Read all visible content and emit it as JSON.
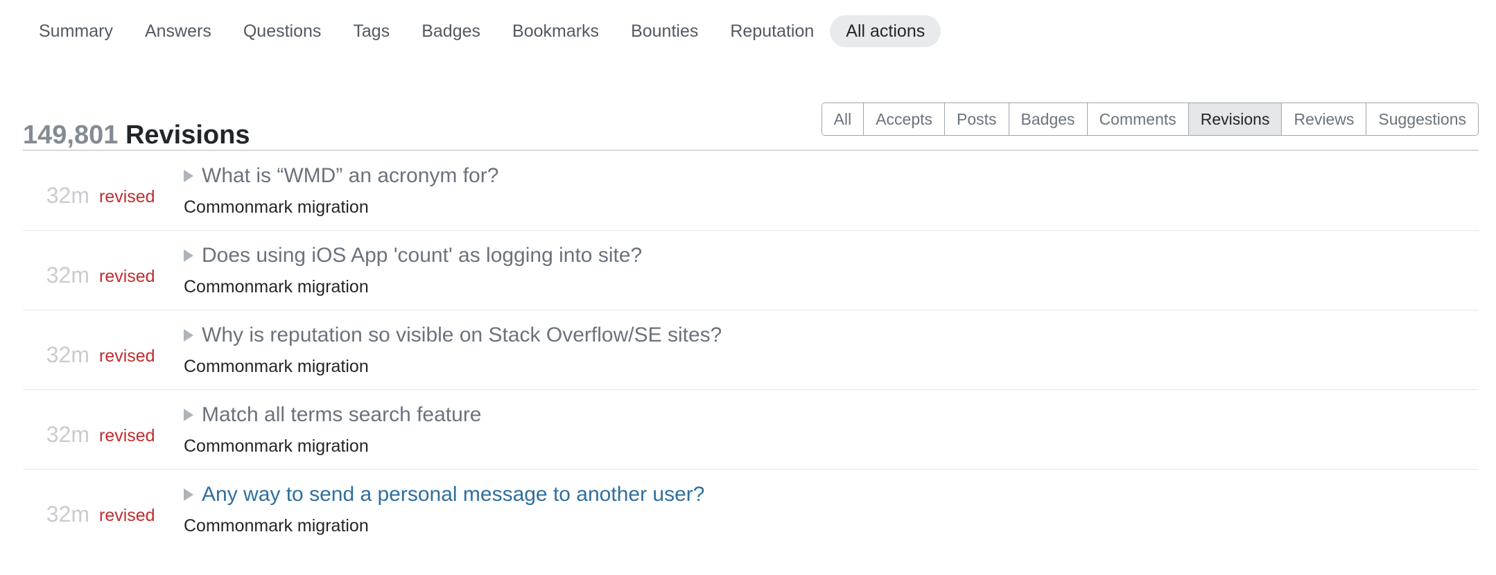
{
  "nav": {
    "items": [
      {
        "label": "Summary",
        "selected": false
      },
      {
        "label": "Answers",
        "selected": false
      },
      {
        "label": "Questions",
        "selected": false
      },
      {
        "label": "Tags",
        "selected": false
      },
      {
        "label": "Badges",
        "selected": false
      },
      {
        "label": "Bookmarks",
        "selected": false
      },
      {
        "label": "Bounties",
        "selected": false
      },
      {
        "label": "Reputation",
        "selected": false
      },
      {
        "label": "All actions",
        "selected": true
      }
    ]
  },
  "header": {
    "count": "149,801",
    "title": "Revisions",
    "filters": [
      {
        "label": "All",
        "selected": false
      },
      {
        "label": "Accepts",
        "selected": false
      },
      {
        "label": "Posts",
        "selected": false
      },
      {
        "label": "Badges",
        "selected": false
      },
      {
        "label": "Comments",
        "selected": false
      },
      {
        "label": "Revisions",
        "selected": true
      },
      {
        "label": "Reviews",
        "selected": false
      },
      {
        "label": "Suggestions",
        "selected": false
      }
    ]
  },
  "activity": {
    "rows": [
      {
        "time": "32m",
        "action": "revised",
        "bullet": "triangle-right-icon",
        "title": "What is “WMD” an acronym for?",
        "title_is_link": false,
        "subtitle": "Commonmark migration"
      },
      {
        "time": "32m",
        "action": "revised",
        "bullet": "triangle-right-icon",
        "title": "Does using iOS App 'count' as logging into site?",
        "title_is_link": false,
        "subtitle": "Commonmark migration"
      },
      {
        "time": "32m",
        "action": "revised",
        "bullet": "triangle-right-icon",
        "title": "Why is reputation so visible on Stack Overflow/SE sites?",
        "title_is_link": false,
        "subtitle": "Commonmark migration"
      },
      {
        "time": "32m",
        "action": "revised",
        "bullet": "triangle-right-icon",
        "title": "Match all terms search feature",
        "title_is_link": false,
        "subtitle": "Commonmark migration"
      },
      {
        "time": "32m",
        "action": "revised",
        "bullet": "triangle-right-icon",
        "title": "Any way to send a personal message to another user?",
        "title_is_link": true,
        "subtitle": "Commonmark migration"
      }
    ]
  },
  "colors": {
    "text_dark": "#232629",
    "text_muted": "#6a737c",
    "count_gray": "#838c95",
    "time_gray": "#c8ccd0",
    "action_red": "#c02d2e",
    "link_blue": "#2f6f9f",
    "pill_bg": "#e8eaed",
    "selected_filter_bg": "#e4e6e8",
    "border": "#9fa6ad",
    "divider": "#e3e6e8"
  }
}
